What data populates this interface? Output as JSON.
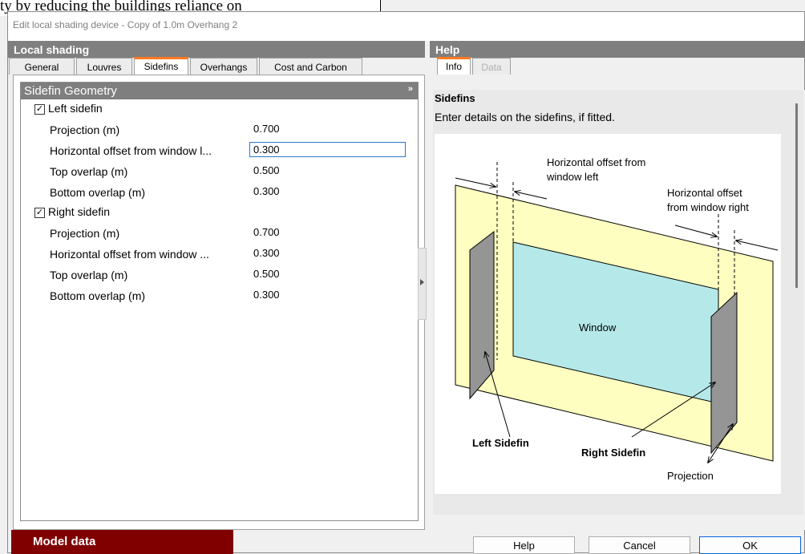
{
  "background": {
    "text": "ty by reducing the buildings reliance on"
  },
  "window": {
    "title": "Edit local shading device - Copy of 1.0m Overhang 2"
  },
  "left": {
    "header": "Local shading",
    "tabs": [
      "General",
      "Louvres",
      "Sidefins",
      "Overhangs",
      "Cost and Carbon"
    ],
    "active_tab": "Sidefins",
    "group": {
      "title": "Sidefin Geometry",
      "collapse_glyph": "»",
      "left_fin": {
        "label": "Left sidefin",
        "checked": true,
        "fields": [
          {
            "label": "Projection (m)",
            "value": "0.700"
          },
          {
            "label": "Horizontal offset from window l...",
            "value": "0.300"
          },
          {
            "label": "Top overlap (m)",
            "value": "0.500"
          },
          {
            "label": "Bottom overlap (m)",
            "value": "0.300"
          }
        ]
      },
      "right_fin": {
        "label": "Right sidefin",
        "checked": true,
        "fields": [
          {
            "label": "Projection (m)",
            "value": "0.700"
          },
          {
            "label": "Horizontal offset from window ...",
            "value": "0.300"
          },
          {
            "label": "Top overlap (m)",
            "value": "0.500"
          },
          {
            "label": "Bottom overlap (m)",
            "value": "0.300"
          }
        ]
      }
    }
  },
  "help": {
    "header": "Help",
    "tabs": [
      "Info",
      "Data"
    ],
    "active_tab": "Info",
    "title": "Sidefins",
    "text": "Enter details on the sidefins, if fitted.",
    "diagram": {
      "label_offset_left_1": "Horizontal offset from",
      "label_offset_left_2": "window left",
      "label_offset_right_1": "Horizontal offset",
      "label_offset_right_2": "from window right",
      "label_window": "Window",
      "label_left_fin": "Left Sidefin",
      "label_right_fin": "Right Sidefin",
      "label_projection": "Projection"
    }
  },
  "footer": {
    "model_data": "Model data",
    "help_button": "Help",
    "cancel_button": "Cancel",
    "ok_button": "OK"
  },
  "colors": {
    "panel_header": "#7f7f7f",
    "tab_accent": "#ff7a21",
    "model_data": "#800000",
    "window_fill": "#b5e9e9",
    "wall_fill": "#fefec0",
    "fin_fill": "#959595"
  }
}
